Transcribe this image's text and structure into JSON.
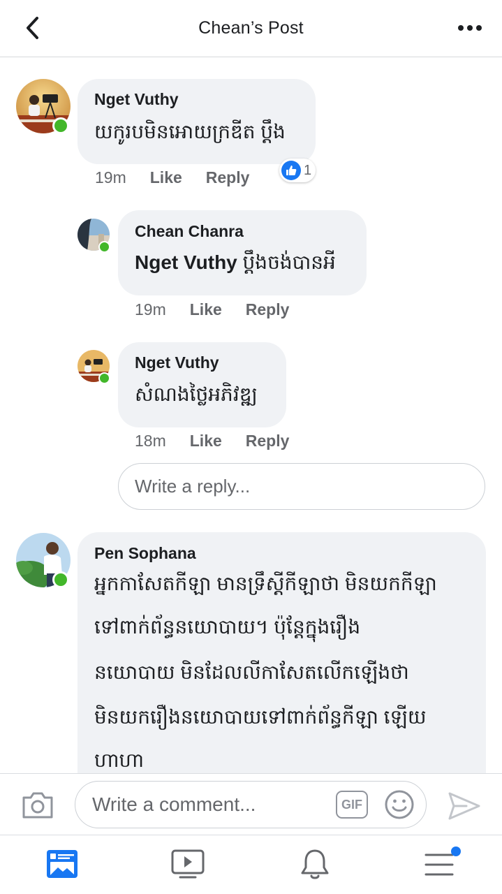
{
  "header": {
    "title": "Chean’s Post",
    "back_icon": "chevron-left-icon",
    "more_icon": "more-horizontal-icon"
  },
  "comments": [
    {
      "author": "Nget Vuthy",
      "text": "យកូរបមិនអោយក្រឌីត ប្តឹង",
      "time": "19m",
      "like": "Like",
      "reply": "Reply",
      "reactions": {
        "icon": "like-icon",
        "count": "1"
      },
      "online": true,
      "replies": [
        {
          "author": "Chean Chanra",
          "mention": "Nget Vuthy",
          "text": " ប្តឹងចង់បានអី",
          "time": "19m",
          "like": "Like",
          "reply": "Reply",
          "online": true
        },
        {
          "author": "Nget Vuthy",
          "text": "សំណងថ្លៃអភិវឌ្ឍ",
          "time": "18m",
          "like": "Like",
          "reply": "Reply",
          "online": true
        }
      ],
      "reply_placeholder": "Write a reply..."
    },
    {
      "author": "Pen Sophana",
      "lines": [
        "អ្នកកាសែតកីឡា មានទ្រឹស្តីកីឡាថា មិនយកកីឡា",
        "ទៅពាក់ព័ន្ធនយោបាយ។ ប៉ុន្តែក្នុងរឿង",
        "នយោបាយ មិនដែលលីកាសែតលើកឡើងថា",
        "មិនយករឿងនយោបាយទៅពាក់ព័ន្ធកីឡា ឡើយ",
        "ហាហា"
      ],
      "online": true
    }
  ],
  "composer": {
    "placeholder": "Write a comment...",
    "gif_label": "GIF",
    "camera_icon": "camera-icon",
    "emoji_icon": "emoji-icon",
    "send_icon": "send-icon"
  },
  "bottom_nav": {
    "items": [
      {
        "name": "news-feed",
        "icon": "news-feed-icon",
        "active": true
      },
      {
        "name": "watch",
        "icon": "video-play-icon",
        "active": false
      },
      {
        "name": "notifications",
        "icon": "bell-icon",
        "active": false
      },
      {
        "name": "menu",
        "icon": "hamburger-menu-icon",
        "active": false,
        "badge": true
      }
    ]
  },
  "colors": {
    "accent": "#1877f2",
    "online": "#42b72a",
    "bubble": "#f0f2f5",
    "secondary_text": "#65676b",
    "icon_gray": "#90949c"
  }
}
